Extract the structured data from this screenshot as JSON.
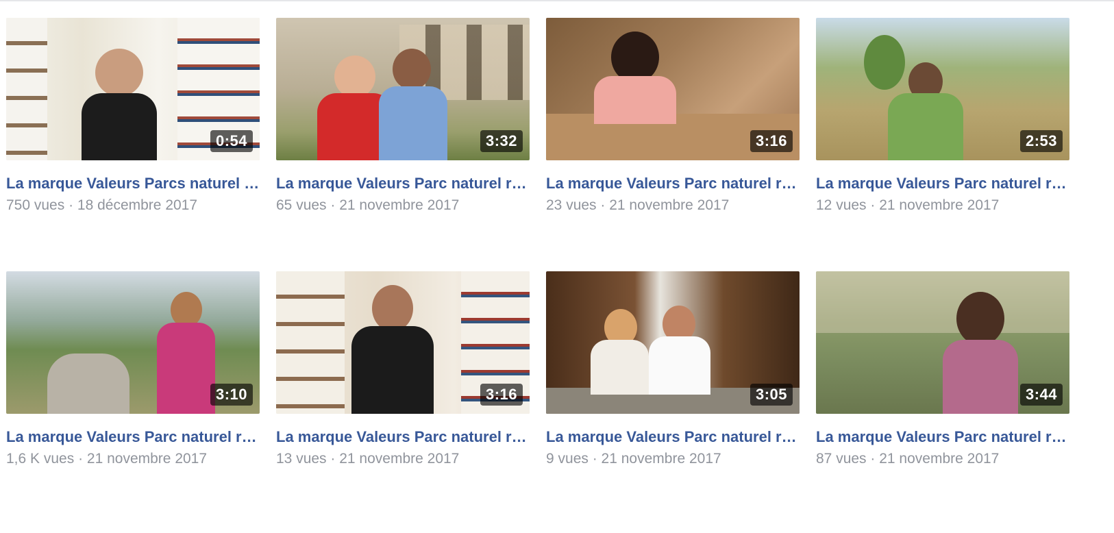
{
  "videos": [
    {
      "title": "La marque Valeurs Parcs naturel réginoal en…",
      "duration": "0:54",
      "views": "750 vues",
      "date": "18 décembre 2017"
    },
    {
      "title": "La marque Valeurs Parc naturel régional dans le Verdon",
      "duration": "3:32",
      "views": "65 vues",
      "date": "21 novembre 2017"
    },
    {
      "title": "La marque Valeurs Parc naturel régional dans le Queyras",
      "duration": "3:16",
      "views": "23 vues",
      "date": "21 novembre 2017"
    },
    {
      "title": "La marque Valeurs Parc naturel régional dans les Préalpes d'Azur",
      "duration": "2:53",
      "views": "12 vues",
      "date": "21 novembre 2017"
    },
    {
      "title": "La marque Valeurs Parc naturel régional dans le Luberon",
      "duration": "3:10",
      "views": "1,6 K vues",
      "date": "21 novembre 2017"
    },
    {
      "title": "La marque Valeurs Parc naturel régional en Camargue",
      "duration": "3:16",
      "views": "13 vues",
      "date": "21 novembre 2017"
    },
    {
      "title": "La marque Valeurs Parc naturel régional dans les Baronnies pro...",
      "duration": "3:05",
      "views": "9 vues",
      "date": "21 novembre 2017"
    },
    {
      "title": "La marque Valeurs Parc naturel régional dans les Alpilles",
      "duration": "3:44",
      "views": "87 vues",
      "date": "21 novembre 2017"
    }
  ],
  "separator": " · ",
  "colors": {
    "title": "#385898",
    "meta": "#90949c",
    "badge_bg": "rgba(0,0,0,0.62)"
  }
}
